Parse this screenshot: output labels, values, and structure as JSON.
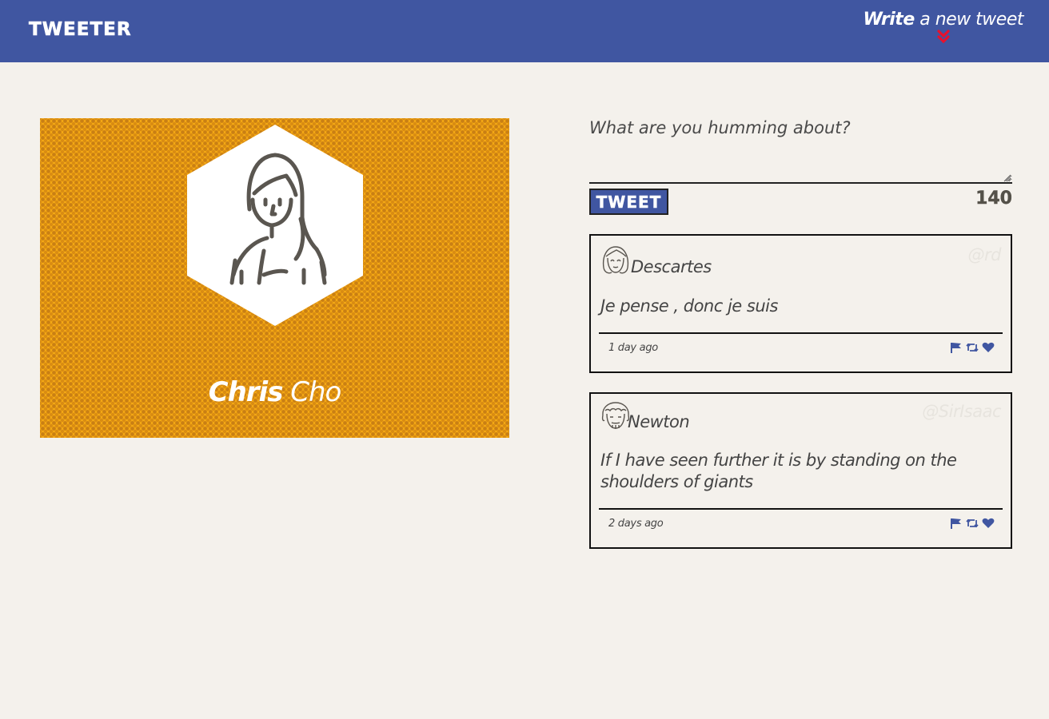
{
  "nav": {
    "logo": "Tweeter",
    "compose_bold": "Write",
    "compose_rest": " a new tweet",
    "compose_icon": "double-chevron-down-icon",
    "accent": "#e8112d"
  },
  "colors": {
    "brand": "#4056a1",
    "card": "#f4a814",
    "background": "#f4f1ec"
  },
  "profile": {
    "first_name": "Chris",
    "last_name": " Cho",
    "avatar_icon": "person-avatar-icon"
  },
  "composer": {
    "placeholder": "What are you humming about?",
    "button_label": "Tweet",
    "counter": "140"
  },
  "tweets": [
    {
      "name": "Descartes",
      "handle": "@rd",
      "body": "Je pense , donc je suis",
      "time": "1 day ago",
      "avatar_icon": "descartes-avatar-icon"
    },
    {
      "name": "Newton",
      "handle": "@SirIsaac",
      "body": "If I have seen further it is by standing on the shoulders of giants",
      "time": "2 days ago",
      "avatar_icon": "newton-avatar-icon"
    }
  ],
  "actions": [
    "flag-icon",
    "retweet-icon",
    "heart-icon"
  ]
}
